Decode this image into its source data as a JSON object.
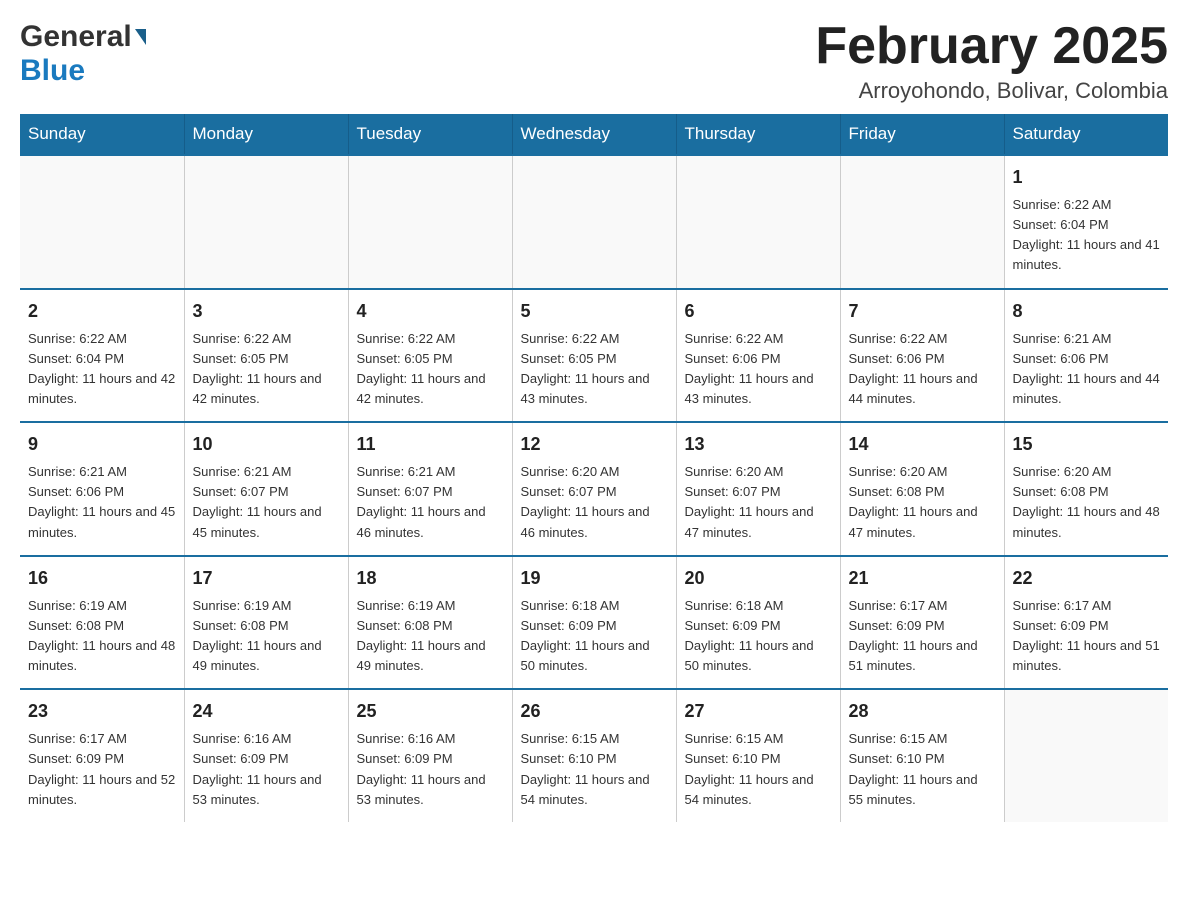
{
  "logo": {
    "general": "General",
    "blue": "Blue"
  },
  "header": {
    "month": "February 2025",
    "location": "Arroyohondo, Bolivar, Colombia"
  },
  "weekdays": [
    "Sunday",
    "Monday",
    "Tuesday",
    "Wednesday",
    "Thursday",
    "Friday",
    "Saturday"
  ],
  "weeks": [
    {
      "days": [
        {
          "num": "",
          "info": ""
        },
        {
          "num": "",
          "info": ""
        },
        {
          "num": "",
          "info": ""
        },
        {
          "num": "",
          "info": ""
        },
        {
          "num": "",
          "info": ""
        },
        {
          "num": "",
          "info": ""
        },
        {
          "num": "1",
          "info": "Sunrise: 6:22 AM\nSunset: 6:04 PM\nDaylight: 11 hours and 41 minutes."
        }
      ]
    },
    {
      "days": [
        {
          "num": "2",
          "info": "Sunrise: 6:22 AM\nSunset: 6:04 PM\nDaylight: 11 hours and 42 minutes."
        },
        {
          "num": "3",
          "info": "Sunrise: 6:22 AM\nSunset: 6:05 PM\nDaylight: 11 hours and 42 minutes."
        },
        {
          "num": "4",
          "info": "Sunrise: 6:22 AM\nSunset: 6:05 PM\nDaylight: 11 hours and 42 minutes."
        },
        {
          "num": "5",
          "info": "Sunrise: 6:22 AM\nSunset: 6:05 PM\nDaylight: 11 hours and 43 minutes."
        },
        {
          "num": "6",
          "info": "Sunrise: 6:22 AM\nSunset: 6:06 PM\nDaylight: 11 hours and 43 minutes."
        },
        {
          "num": "7",
          "info": "Sunrise: 6:22 AM\nSunset: 6:06 PM\nDaylight: 11 hours and 44 minutes."
        },
        {
          "num": "8",
          "info": "Sunrise: 6:21 AM\nSunset: 6:06 PM\nDaylight: 11 hours and 44 minutes."
        }
      ]
    },
    {
      "days": [
        {
          "num": "9",
          "info": "Sunrise: 6:21 AM\nSunset: 6:06 PM\nDaylight: 11 hours and 45 minutes."
        },
        {
          "num": "10",
          "info": "Sunrise: 6:21 AM\nSunset: 6:07 PM\nDaylight: 11 hours and 45 minutes."
        },
        {
          "num": "11",
          "info": "Sunrise: 6:21 AM\nSunset: 6:07 PM\nDaylight: 11 hours and 46 minutes."
        },
        {
          "num": "12",
          "info": "Sunrise: 6:20 AM\nSunset: 6:07 PM\nDaylight: 11 hours and 46 minutes."
        },
        {
          "num": "13",
          "info": "Sunrise: 6:20 AM\nSunset: 6:07 PM\nDaylight: 11 hours and 47 minutes."
        },
        {
          "num": "14",
          "info": "Sunrise: 6:20 AM\nSunset: 6:08 PM\nDaylight: 11 hours and 47 minutes."
        },
        {
          "num": "15",
          "info": "Sunrise: 6:20 AM\nSunset: 6:08 PM\nDaylight: 11 hours and 48 minutes."
        }
      ]
    },
    {
      "days": [
        {
          "num": "16",
          "info": "Sunrise: 6:19 AM\nSunset: 6:08 PM\nDaylight: 11 hours and 48 minutes."
        },
        {
          "num": "17",
          "info": "Sunrise: 6:19 AM\nSunset: 6:08 PM\nDaylight: 11 hours and 49 minutes."
        },
        {
          "num": "18",
          "info": "Sunrise: 6:19 AM\nSunset: 6:08 PM\nDaylight: 11 hours and 49 minutes."
        },
        {
          "num": "19",
          "info": "Sunrise: 6:18 AM\nSunset: 6:09 PM\nDaylight: 11 hours and 50 minutes."
        },
        {
          "num": "20",
          "info": "Sunrise: 6:18 AM\nSunset: 6:09 PM\nDaylight: 11 hours and 50 minutes."
        },
        {
          "num": "21",
          "info": "Sunrise: 6:17 AM\nSunset: 6:09 PM\nDaylight: 11 hours and 51 minutes."
        },
        {
          "num": "22",
          "info": "Sunrise: 6:17 AM\nSunset: 6:09 PM\nDaylight: 11 hours and 51 minutes."
        }
      ]
    },
    {
      "days": [
        {
          "num": "23",
          "info": "Sunrise: 6:17 AM\nSunset: 6:09 PM\nDaylight: 11 hours and 52 minutes."
        },
        {
          "num": "24",
          "info": "Sunrise: 6:16 AM\nSunset: 6:09 PM\nDaylight: 11 hours and 53 minutes."
        },
        {
          "num": "25",
          "info": "Sunrise: 6:16 AM\nSunset: 6:09 PM\nDaylight: 11 hours and 53 minutes."
        },
        {
          "num": "26",
          "info": "Sunrise: 6:15 AM\nSunset: 6:10 PM\nDaylight: 11 hours and 54 minutes."
        },
        {
          "num": "27",
          "info": "Sunrise: 6:15 AM\nSunset: 6:10 PM\nDaylight: 11 hours and 54 minutes."
        },
        {
          "num": "28",
          "info": "Sunrise: 6:15 AM\nSunset: 6:10 PM\nDaylight: 11 hours and 55 minutes."
        },
        {
          "num": "",
          "info": ""
        }
      ]
    }
  ]
}
